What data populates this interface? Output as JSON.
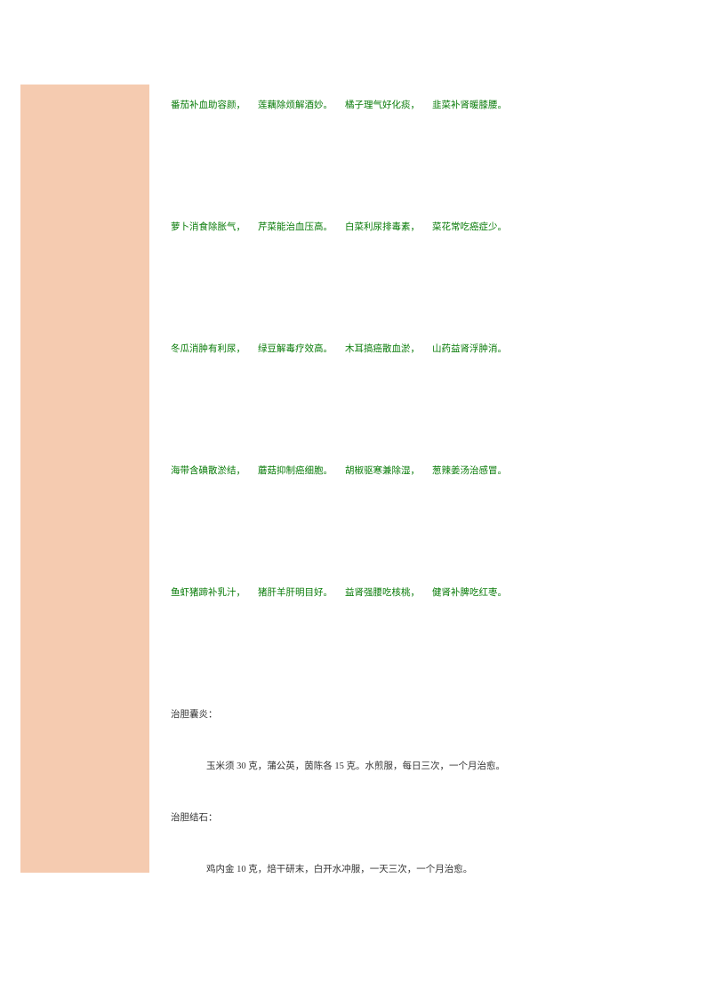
{
  "verses": [
    [
      "番茄补血助容颜，",
      "莲藕除烦解酒妙。",
      "橘子理气好化痰，",
      "韭菜补肾暖膝腰。"
    ],
    [
      "萝卜消食除胀气，",
      "芹菜能治血压高。",
      "白菜利尿排毒素，",
      "菜花常吃癌症少。"
    ],
    [
      "冬瓜消肿有利尿，",
      "绿豆解毒疗效高。",
      "木耳搞癌散血淤，",
      "山药益肾浮肿消。"
    ],
    [
      "海带含碘散淤结，",
      "蘑菇抑制癌细胞。",
      "胡椒驱寒兼除湿，",
      "葱辣姜汤治感冒。"
    ],
    [
      "鱼虾猪蹄补乳汁，",
      "猪肝羊肝明目好。",
      "益肾强腰吃核桃，",
      "健肾补脾吃红枣。"
    ]
  ],
  "recipes": [
    {
      "title": "治胆囊炎：",
      "body": "玉米须 30 克，蒲公英，茵陈各 15 克。水煎服，每日三次，一个月治愈。"
    },
    {
      "title": "治胆结石：",
      "body": "鸡内金 10 克，焙干研末，白开水冲服，一天三次，一个月治愈。"
    }
  ]
}
